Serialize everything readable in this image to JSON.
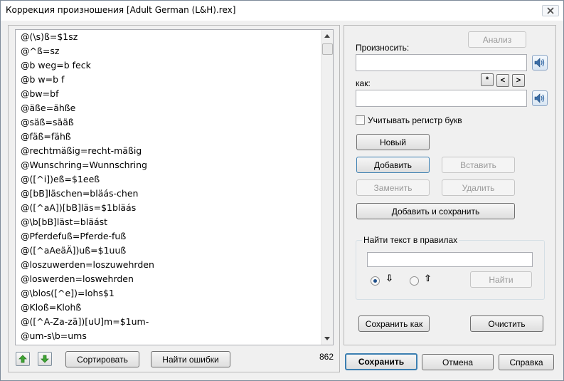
{
  "window": {
    "title": "Коррекция произношения [Adult German (L&H).rex]"
  },
  "rules_list": {
    "items": [
      "@(\\s)ß=$1sz",
      "@^ß=sz",
      "@b weg=b feck",
      "@b w=b f",
      "@bw=bf",
      "@äße=ähße",
      "@säß=sääß",
      "@fäß=fähß",
      "@rechtmäßig=recht-mäßig",
      "@Wunschring=Wunnschring",
      "@([^i])eß=$1eeß",
      "@[bB]läschen=bläás-chen",
      "@([^aA])[bB]läs=$1bläás",
      "@\\b[bB]läst=bläást",
      "@Pferdefuß=Pferde-fuß",
      "@([^aAeäÄ])uß=$1uuß",
      "@loszuwerden=loszuwehrden",
      "@loswerden=loswehrden",
      "@\\blos([^e])=lohs$1",
      "@Kloß=Klohß",
      "@([^A-Za-zä])[uU]m=$1um-",
      "@um-s\\b=ums"
    ],
    "count": "862"
  },
  "left_buttons": {
    "sort": "Сортировать",
    "find_errors": "Найти ошибки"
  },
  "right_panel": {
    "analyze": "Анализ",
    "pronounce_label": "Произносить:",
    "pronounce_value": "",
    "as_label": "как:",
    "as_value": "",
    "star_button": "*",
    "prev_button": "<",
    "next_button": ">",
    "case_checkbox": "Учитывать регистр букв",
    "case_checked": false,
    "new": "Новый",
    "add": "Добавить",
    "insert": "Вставить",
    "replace": "Заменить",
    "delete": "Удалить",
    "add_and_save": "Добавить и сохранить",
    "find_group_title": "Найти текст в правилах",
    "find_value": "",
    "direction_down": "⇩",
    "direction_up": "⇧",
    "find": "Найти",
    "save_as": "Сохранить как",
    "clear": "Очистить"
  },
  "bottom_buttons": {
    "save": "Сохранить",
    "cancel": "Отмена",
    "help": "Справка"
  },
  "colors": {
    "accent": "#3c7fb1",
    "arrow_green": "#3fa535"
  }
}
